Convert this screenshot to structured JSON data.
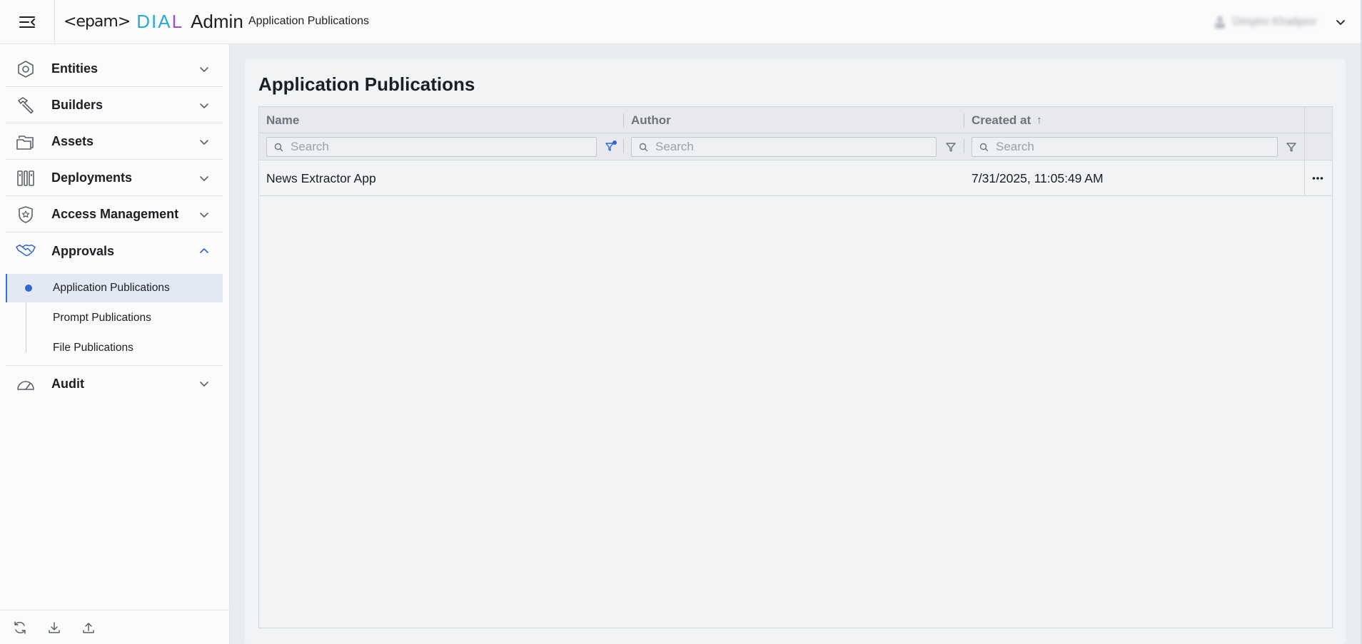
{
  "header": {
    "logo_epam": "<epam>",
    "logo_dial_main": "DIA",
    "logo_dial_l": "L",
    "logo_admin": "Admin",
    "page_title": "Application Publications",
    "user_name": "Dmytro Khalipov"
  },
  "sidebar": {
    "items": [
      {
        "label": "Entities",
        "icon": "hexagon-icon",
        "expanded": false
      },
      {
        "label": "Builders",
        "icon": "hammer-icon",
        "expanded": false
      },
      {
        "label": "Assets",
        "icon": "folders-icon",
        "expanded": false
      },
      {
        "label": "Deployments",
        "icon": "deployments-icon",
        "expanded": false
      },
      {
        "label": "Access Management",
        "icon": "shield-star-icon",
        "expanded": false
      },
      {
        "label": "Approvals",
        "icon": "handshake-icon",
        "expanded": true
      },
      {
        "label": "Audit",
        "icon": "gauge-icon",
        "expanded": false
      }
    ],
    "approvals_sub": [
      {
        "label": "Application Publications",
        "active": true
      },
      {
        "label": "Prompt Publications",
        "active": false
      },
      {
        "label": "File Publications",
        "active": false
      }
    ],
    "bottom_icons": [
      "refresh-icon",
      "download-icon",
      "upload-icon"
    ]
  },
  "main": {
    "title": "Application Publications",
    "table": {
      "columns": [
        {
          "label": "Name",
          "sort": ""
        },
        {
          "label": "Author",
          "sort": ""
        },
        {
          "label": "Created at",
          "sort": "↑"
        }
      ],
      "search_placeholder": "Search",
      "rows": [
        {
          "name": "News Extractor App",
          "author": "",
          "created_at": "7/31/2025, 11:05:49 AM"
        }
      ]
    }
  },
  "colors": {
    "accent": "#2f66d0",
    "dial_blue": "#2aa9d8",
    "dial_purple": "#a34cd3",
    "active_bg": "#e2e9f5"
  }
}
